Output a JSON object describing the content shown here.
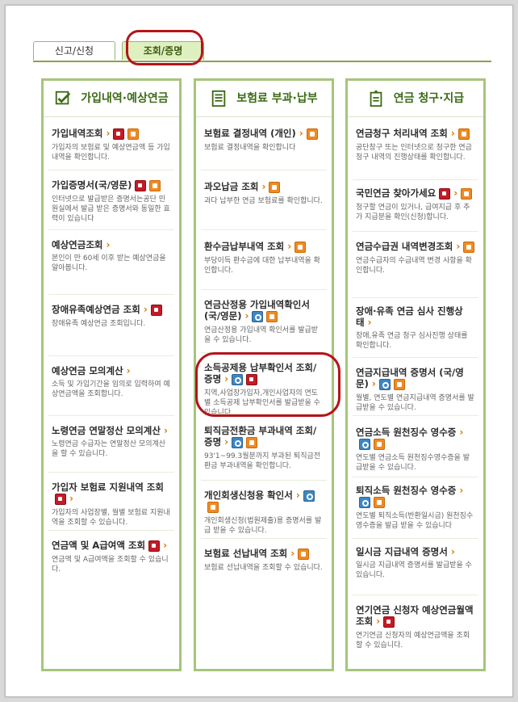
{
  "tabs": {
    "tab1_label": "신고/신청",
    "tab2_label": "조회/증명"
  },
  "columns": [
    {
      "header": "가입내역·예상연금",
      "icon": "check-icon",
      "items": [
        {
          "title": "가입내역조회",
          "desc": "가입자의 보험료 및 예상연금액 등 가입내역을 확인합니다."
        },
        {
          "title": "가입증명서(국/영문)",
          "desc": "인터넷으로 발급받은 증명서는공단 민원실에서 발급 받은 증명서와 동일한 효력이 있습니다"
        },
        {
          "title": "예상연금조회",
          "desc": "본인이 만 60세 이후 받는 예상연금을 알아봅니다."
        },
        {
          "title": "장애유족예상연금 조회",
          "desc": "장애유족 예상연금 조회입니다."
        },
        {
          "title": "예상연금 모의계산",
          "desc": "소득 및 가입기간을 임의로 입력하여 예상연금액을 조회합니다."
        },
        {
          "title": "노령연금 연말정산 모의계산",
          "desc": "노령연금 수급자는 연말정산 모의계산을 할 수 있습니다."
        },
        {
          "title": "가입자 보험료 지원내역 조회",
          "desc": "가입자의 사업장별, 월별 보험료 지원내역을 조회할 수 있습니다."
        },
        {
          "title": "연금액 및 A급여액 조회",
          "desc": "연금액 및 A급여액을 조회할 수 있습니다."
        }
      ]
    },
    {
      "header": "보험료 부과·납부",
      "icon": "notepad-icon",
      "items": [
        {
          "title": "보험료 결정내역 (개인)",
          "desc": "보험료 결정내역을 확인합니다"
        },
        {
          "title": "과오납금 조회",
          "desc": "과다 납부한 연금 보험료를 확인합니다."
        },
        {
          "title": "환수금납부내역 조회",
          "desc": "부당이득 환수금에 대한 납부내역을 확인합니다."
        },
        {
          "title": "연금산정용 가입내역확인서(국/영문)",
          "desc": "연금산정용 가입내역 확인서를 발급받을 수 있습니다."
        },
        {
          "title": "소득공제용 납부확인서 조회/증명",
          "desc": "지역,사업장가입자,개인사업자의 연도별 소득공제 납부확인서를 발급받을 수 있습니다."
        },
        {
          "title": "퇴직금전환금 부과내역 조회/증명",
          "desc": "93'1~99.3월분까지 부과된 퇴직금전환금 부과내역을 확인합니다."
        },
        {
          "title": "개인회생신청용 확인서",
          "desc": "개인회생신청(법원제출)용 증명서를 발급 받을 수 있습니다."
        },
        {
          "title": "보험료 선납내역 조회",
          "desc": "보험료 선납내역을 조회할 수 있습니다."
        }
      ]
    },
    {
      "header": "연금 청구·지급",
      "icon": "tag-icon",
      "items": [
        {
          "title": "연금청구 처리내역 조회",
          "desc": "공단창구 또는 인터넷으로 청구한 연금청구 내역의 진행상태를 확인합니다."
        },
        {
          "title": "국민연금 찾아가세요",
          "desc": "청구할 연금이 있거나, 급여지급 후 추가 지급분을 확인(신청)합니다."
        },
        {
          "title": "연금수급권 내역변경조회",
          "desc": "연금수급자의 수급내역 변경 사항을 확인합니다."
        },
        {
          "title": "장애·유족 연금 심사 진행상태",
          "desc": "장애,유족 연금 청구 심사진행 상태를 확인합니다."
        },
        {
          "title": "연금지급내역 증명서 (국/영문)",
          "desc": "월별, 연도별 연금지급내역 증명서를 발급받을 수 있습니다."
        },
        {
          "title": "연금소득 원천징수 영수증",
          "desc": "연도별 연금소득 원천징수영수증을 발급받을 수 있습니다."
        },
        {
          "title": "퇴직소득 원천징수 영수증",
          "desc": "연도별 퇴직소득(반환일시금) 원천징수 영수증을 발급 받을 수 있습니다"
        },
        {
          "title": "일시금 지급내역 증명서",
          "desc": "일시금 지급내역 증명서를 발급받을 수 있습니다."
        },
        {
          "title": "연기연금 신청자 예상연금월액 조회",
          "desc": "연기연금 신청자의 예상연금액을 조회할 수 있습니다."
        }
      ]
    }
  ],
  "colors": {
    "accent": "#a6c57a",
    "header_text": "#3c6b16",
    "highlight": "#b5141a",
    "chevron": "#d27800"
  }
}
